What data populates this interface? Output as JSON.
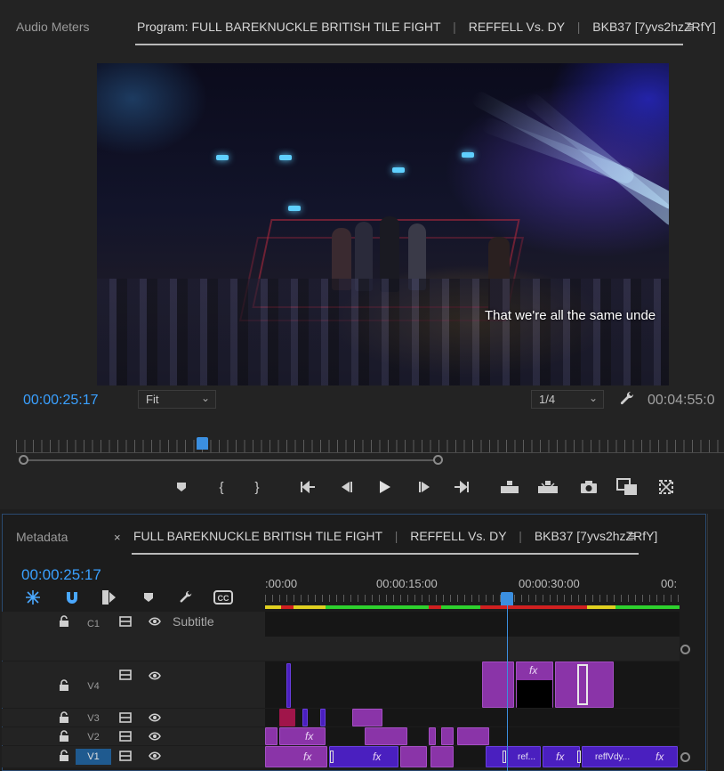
{
  "program_monitor": {
    "audio_meters_tab": "Audio Meters",
    "program_tab_prefix": "Program:",
    "sequence_title_parts": [
      "FULL BAREKNUCKLE BRITISH TILE FIGHT",
      "REFFELL Vs. DY",
      "BKB37 [7yvs2hzZRfY]"
    ],
    "caption_text": "That we're all the same unde",
    "current_timecode": "00:00:25:17",
    "zoom_value": "Fit",
    "resolution_value": "1/4",
    "duration_timecode": "00:04:55:0"
  },
  "transport_icons": [
    "add-marker",
    "mark-in",
    "mark-out",
    "go-to-in",
    "step-back",
    "play",
    "step-forward",
    "go-to-out",
    "lift",
    "extract",
    "export-frame",
    "insert-overlay",
    "settings"
  ],
  "timeline": {
    "metadata_tab": "Metadata",
    "close_glyph": "×",
    "sequence_title_parts": [
      "FULL BAREKNUCKLE BRITISH TILE FIGHT",
      "REFFELL Vs. DY",
      "BKB37 [7yvs2hzZRfY]"
    ],
    "timecode": "00:00:25:17",
    "ruler_labels": [
      ":00:00",
      "00:00:15:00",
      "00:00:30:00",
      "00:"
    ],
    "tracks": [
      {
        "id": "C1",
        "label": "Subtitle"
      },
      {
        "id": "V4"
      },
      {
        "id": "V3"
      },
      {
        "id": "V2"
      },
      {
        "id": "V1"
      }
    ],
    "fx_label": "fx",
    "clip_labels": {
      "v1_a": "ref...",
      "v1_b": "reffVdy..."
    }
  },
  "colors": {
    "accent": "#3aa0ff",
    "clip_purple": "#8a34a8",
    "clip_indigo": "#4a1fbf",
    "render_green": "#2ed12e",
    "render_yellow": "#e0d020",
    "render_red": "#d02020"
  }
}
